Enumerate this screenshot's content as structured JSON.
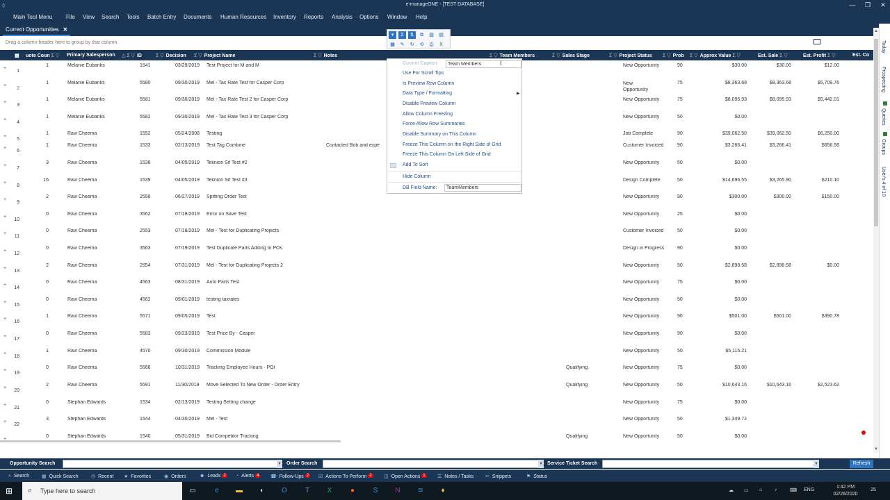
{
  "window": {
    "title": "e-manageONE - [TEST DATABASE]",
    "minimize": "—",
    "maximize": "❐",
    "close": "✕"
  },
  "menu": [
    "Main Tool Menu",
    "File",
    "View",
    "Search",
    "Tools",
    "Batch Entry",
    "Documents",
    "Human Resources",
    "Inventory",
    "Reports",
    "Analysis",
    "Options",
    "Window",
    "Help"
  ],
  "tab": {
    "label": "Current Opportunities",
    "close": "✕"
  },
  "group_hint": "Drag a column header here to group by that column.",
  "columns": {
    "quote_count": "uote Coun",
    "primary_salesperson": "Primary Salesperson",
    "id": "ID",
    "decision": "Decision",
    "project_name": "Project Name",
    "notes": "Notes",
    "team_members": "Team Members",
    "sales_stage": "Sales Stage",
    "project_status": "Project Status",
    "prob": "Prob",
    "approx_value": "Approx Value",
    "est_sale": "Est. Sale",
    "est_profit": "Est. Profit",
    "est_cost": "Est. Co"
  },
  "rows": [
    {
      "n": "1",
      "q": "1",
      "sp": "Melanie Eubanks",
      "id": "1541",
      "dec": "03/29/2019",
      "name": "Test Project for M and M",
      "notes": "",
      "stage": "",
      "status": "New Opportunity",
      "prob": "90",
      "approx": "$30.00",
      "sale": "$30.00",
      "profit": "$12.00"
    },
    {
      "n": "2",
      "q": "1",
      "sp": "Melanie Eubanks",
      "id": "5580",
      "dec": "09/30/2019",
      "name": "Mel - Tax Rate Test for Casper Corp",
      "notes": "",
      "stage": "",
      "status": "New Opportunity",
      "prob": "75",
      "approx": "$8,363.68",
      "sale": "$8,363.68",
      "profit": "$5,709.76"
    },
    {
      "n": "3",
      "q": "1",
      "sp": "Melanie Eubanks",
      "id": "5581",
      "dec": "09/30/2019",
      "name": "Mel - Tax Rate Test 2 for Casper Corp",
      "notes": "",
      "stage": "",
      "status": "New Opportunity",
      "prob": "75",
      "approx": "$8,095.93",
      "sale": "$8,095.93",
      "profit": "$5,442.01"
    },
    {
      "n": "4",
      "q": "1",
      "sp": "Melanie Eubanks",
      "id": "5582",
      "dec": "09/30/2019",
      "name": "Mel - Tax Rate Test 3 for Casper Corp",
      "notes": "",
      "stage": "",
      "status": "New Opportunity",
      "prob": "50",
      "approx": "$0.00",
      "sale": "",
      "profit": ""
    },
    {
      "n": "5",
      "q": "1",
      "sp": "Ravi Cheema",
      "id": "1552",
      "dec": "05/24/2008",
      "name": "Testing",
      "notes": "",
      "stage": "",
      "status": "Job Complete",
      "prob": "90",
      "approx": "$39,062.50",
      "sale": "$39,062.50",
      "profit": "$6,250.00"
    },
    {
      "n": "6",
      "q": "1",
      "sp": "Ravi Cheema",
      "id": "1533",
      "dec": "02/13/2019",
      "name": "Test Tag Combine",
      "notes": "Contacted Bob and expe",
      "stage": "",
      "status": "Customer Invoiced",
      "prob": "90",
      "approx": "$3,266.41",
      "sale": "$3,266.41",
      "profit": "$656.56"
    },
    {
      "n": "7",
      "q": "3",
      "sp": "Ravi Cheema",
      "id": "1538",
      "dec": "04/05/2019",
      "name": "Teknion Sif Test #2",
      "notes": "",
      "stage": "",
      "status": "New Opportunity",
      "prob": "50",
      "approx": "$0.00",
      "sale": "",
      "profit": ""
    },
    {
      "n": "8",
      "q": "16",
      "sp": "Ravi Cheema",
      "id": "1539",
      "dec": "04/05/2019",
      "name": "Teknion Sif Test #3",
      "notes": "",
      "stage": "",
      "status": "Design Complete",
      "prob": "50",
      "approx": "$14,696.55",
      "sale": "$3,265.90",
      "profit": "$210.10"
    },
    {
      "n": "9",
      "q": "2",
      "sp": "Ravi Cheema",
      "id": "2558",
      "dec": "06/27/2019",
      "name": "Spitting Order Test",
      "notes": "",
      "stage": "",
      "status": "New Opportunity",
      "prob": "90",
      "approx": "$300.00",
      "sale": "$300.00",
      "profit": "$150.00"
    },
    {
      "n": "10",
      "q": "0",
      "sp": "Ravi Cheema",
      "id": "3562",
      "dec": "07/18/2019",
      "name": "Error on Save Test",
      "notes": "",
      "stage": "",
      "status": "New Opportunity",
      "prob": "25",
      "approx": "$0.00",
      "sale": "",
      "profit": ""
    },
    {
      "n": "11",
      "q": "0",
      "sp": "Ravi Cheema",
      "id": "2553",
      "dec": "07/18/2019",
      "name": "Mel - Test for Duplicating Projects",
      "notes": "",
      "stage": "",
      "status": "Customer Invoiced",
      "prob": "50",
      "approx": "$0.00",
      "sale": "",
      "profit": ""
    },
    {
      "n": "12",
      "q": "0",
      "sp": "Ravi Cheema",
      "id": "3563",
      "dec": "07/19/2019",
      "name": "Test Duplicate Parts Adding to POs",
      "notes": "",
      "stage": "",
      "status": "Design in Progress",
      "prob": "90",
      "approx": "$0.00",
      "sale": "",
      "profit": ""
    },
    {
      "n": "13",
      "q": "2",
      "sp": "Ravi Cheema",
      "id": "2554",
      "dec": "07/31/2019",
      "name": "Mel - Test for Duplicating Projects 2",
      "notes": "",
      "stage": "",
      "status": "New Opportunity",
      "prob": "50",
      "approx": "$2,898.58",
      "sale": "$2,898.58",
      "profit": "$0.00"
    },
    {
      "n": "14",
      "q": "0",
      "sp": "Ravi Cheema",
      "id": "4563",
      "dec": "08/31/2019",
      "name": "Auto Parts Test",
      "notes": "",
      "stage": "",
      "status": "New Opportunity",
      "prob": "75",
      "approx": "$0.00",
      "sale": "",
      "profit": ""
    },
    {
      "n": "15",
      "q": "0",
      "sp": "Ravi Cheema",
      "id": "4562",
      "dec": "09/01/2019",
      "name": "testing taxrates",
      "notes": "",
      "stage": "",
      "status": "New Opportunity",
      "prob": "50",
      "approx": "$0.00",
      "sale": "",
      "profit": ""
    },
    {
      "n": "16",
      "q": "1",
      "sp": "Ravi Cheema",
      "id": "5571",
      "dec": "09/05/2019",
      "name": "Test",
      "notes": "",
      "stage": "",
      "status": "New Opportunity",
      "prob": "90",
      "approx": "$501.00",
      "sale": "$501.00",
      "profit": "$390.78"
    },
    {
      "n": "17",
      "q": "0",
      "sp": "Ravi Cheema",
      "id": "5583",
      "dec": "09/23/2019",
      "name": "Test Price By - Casper",
      "notes": "",
      "stage": "",
      "status": "New Opportunity",
      "prob": "90",
      "approx": "$0.00",
      "sale": "",
      "profit": ""
    },
    {
      "n": "18",
      "q": "1",
      "sp": "Ravi Cheema",
      "id": "4570",
      "dec": "09/30/2019",
      "name": "Commission Module",
      "notes": "",
      "stage": "",
      "status": "New Opportunity",
      "prob": "50",
      "approx": "$5,115.21",
      "sale": "",
      "profit": ""
    },
    {
      "n": "19",
      "q": "0",
      "sp": "Ravi Cheema",
      "id": "5568",
      "dec": "10/31/2019",
      "name": "Tracking Employee Hours - POI",
      "notes": "",
      "stage": "Qualifying",
      "status": "New Opportunity",
      "prob": "75",
      "approx": "$0.00",
      "sale": "",
      "profit": ""
    },
    {
      "n": "20",
      "q": "2",
      "sp": "Ravi Cheema",
      "id": "5591",
      "dec": "11/30/2019",
      "name": "Move Selected To New Order - Order Entry",
      "notes": "",
      "stage": "Qualifying",
      "status": "New Opportunity",
      "prob": "50",
      "approx": "$10,643.16",
      "sale": "$10,643.16",
      "profit": "$2,523.62"
    },
    {
      "n": "21",
      "q": "0",
      "sp": "Stephan Edwards",
      "id": "1534",
      "dec": "02/13/2019",
      "name": "Testing Setting change",
      "notes": "",
      "stage": "",
      "status": "New Opportunity",
      "prob": "75",
      "approx": "$0.00",
      "sale": "",
      "profit": ""
    },
    {
      "n": "22",
      "q": "3",
      "sp": "Stephan Edwards",
      "id": "1544",
      "dec": "04/30/2019",
      "name": "Mel - Test",
      "notes": "",
      "stage": "",
      "status": "New Opportunity",
      "prob": "50",
      "approx": "$1,349.72",
      "sale": "",
      "profit": ""
    },
    {
      "n": "",
      "q": "0",
      "sp": "Stephan Edwards",
      "id": "1540",
      "dec": "05/31/2019",
      "name": "Bid Competitor Tracking",
      "notes": "",
      "stage": "Qualifying",
      "status": "New Opportunity",
      "prob": "50",
      "approx": "$0.00",
      "sale": "",
      "profit": ""
    }
  ],
  "context_menu": {
    "caption_label": "Current Caption",
    "caption_value": "Team Members",
    "items": [
      "Use For Scroll Tips",
      "Is Preview Row Column",
      "Data Type / Formatting",
      "Disable Preview Column",
      "Allow Column Freezing",
      "Force Allow Row Summaries",
      "Disable Summary on This Column",
      "Freeze This Column on the Right Side of Grid",
      "Freeze This Column On Left Side of Grid",
      "Add To Sort",
      "Hide Column"
    ],
    "field_label": "DB Field Name:",
    "field_value": "TeamMembers"
  },
  "right_tabs": [
    "Today",
    "Prospecting",
    "Queries",
    "Groups",
    "User's 4 of 10"
  ],
  "search": {
    "opportunity_label": "Opportunity Search",
    "order_label": "Order Search",
    "service_label": "Service Ticket Search",
    "refresh": "Refresh"
  },
  "bottom_items": [
    {
      "label": "Search",
      "badge": ""
    },
    {
      "label": "Quick Search",
      "badge": ""
    },
    {
      "label": "Recent",
      "badge": ""
    },
    {
      "label": "Favorites",
      "badge": ""
    },
    {
      "label": "Orders",
      "badge": ""
    },
    {
      "label": "Leads",
      "badge": "2"
    },
    {
      "label": "Alerts",
      "badge": "4"
    },
    {
      "label": "Follow-Ups",
      "badge": "2"
    },
    {
      "label": "Actions To Perform",
      "badge": "2"
    },
    {
      "label": "Open Actions",
      "badge": "1"
    },
    {
      "label": "Notes / Tasks",
      "badge": ""
    },
    {
      "label": "Snippets",
      "badge": ""
    },
    {
      "label": "Status",
      "badge": ""
    }
  ],
  "taskbar": {
    "search_placeholder": "Type here to search",
    "lang": "ENG",
    "time": "1:42 PM",
    "date": "02/26/2020",
    "notif": "25"
  },
  "colors": {
    "chrome": "#1b3555",
    "accent": "#2f74c0",
    "menu_text": "#1f4f86"
  }
}
